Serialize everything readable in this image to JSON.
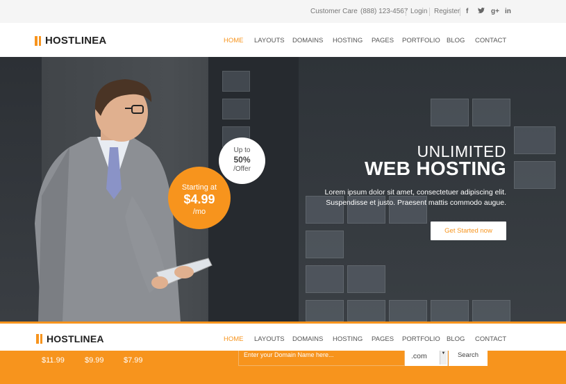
{
  "topbar": {
    "customer_care_label": "Customer Care",
    "phone": "(888) 123-4567",
    "login": "Login",
    "register": "Register",
    "social": [
      "f",
      "t",
      "g+",
      "in"
    ]
  },
  "brand": {
    "name": "HOSTLINEA"
  },
  "nav": {
    "items": [
      "HOME",
      "LAYOUTS",
      "DOMAINS",
      "HOSTING",
      "PAGES",
      "PORTFOLIO",
      "BLOG",
      "CONTACT"
    ],
    "active": "HOME"
  },
  "hero": {
    "offer": {
      "up_to": "Up to",
      "percent": "50%",
      "suffix": "/Offer"
    },
    "price": {
      "starting_at": "Starting at",
      "amount": "$4.99",
      "per": "/mo"
    },
    "title_line1": "UNLIMITED",
    "title_line2": "WEB HOSTING",
    "description": "Lorem ipsum dolor sit amet, consectetuer adipiscing elit. Suspendisse et justo. Praesent mattis commodo augue.",
    "cta": "Get Started now"
  },
  "domain_search": {
    "prices": [
      "$11.99",
      "$9.99",
      "$7.99"
    ],
    "placeholder": "Enter your Domain Name here...",
    "tld": ".com",
    "search_label": "Search"
  },
  "colors": {
    "accent": "#f7941d"
  }
}
